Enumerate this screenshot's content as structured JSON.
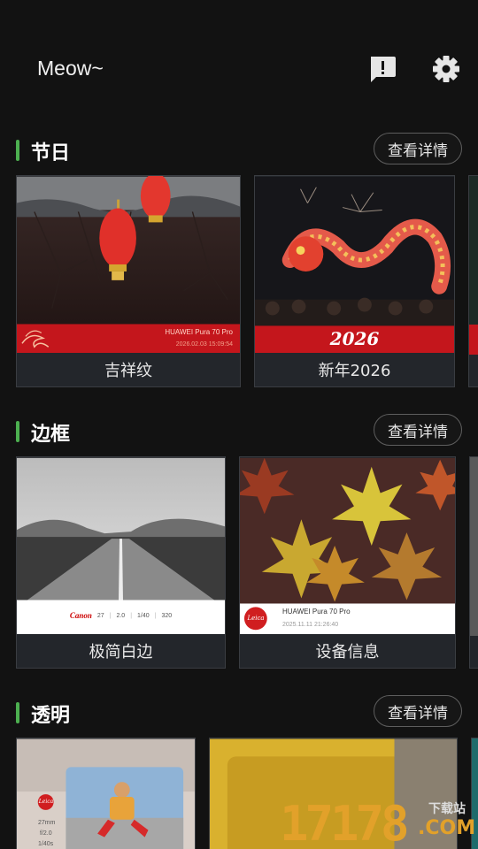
{
  "app": {
    "title": "Meow~"
  },
  "icons": {
    "feedback": "feedback-icon",
    "settings": "gear-icon"
  },
  "colors": {
    "accent": "#4caf50",
    "background": "#121212",
    "card": "#23262b",
    "banner_red": "#c4161c"
  },
  "sections": [
    {
      "title": "节日",
      "detail_label": "查看详情",
      "cards": [
        {
          "label": "吉祥纹",
          "camera": "HUAWEI Pura 70 Pro",
          "date": "2026.02.03 15:09:54"
        },
        {
          "label": "新年2026",
          "banner_text": "2026"
        }
      ]
    },
    {
      "title": "边框",
      "detail_label": "查看详情",
      "cards": [
        {
          "label": "极简白边",
          "brand": "Canon",
          "params": [
            "27",
            "2.0",
            "1/40",
            "320"
          ]
        },
        {
          "label": "设备信息",
          "brand": "Leica",
          "camera": "HUAWEI Pura 70 Pro",
          "date": "2025.11.11 21:26:40"
        }
      ]
    },
    {
      "title": "透明",
      "detail_label": "查看详情",
      "cards": [
        {
          "brand": "Leica",
          "params": [
            "27mm",
            "f/2.0",
            "1/40s"
          ]
        },
        {}
      ]
    }
  ],
  "watermark": {
    "number": "17178",
    "text": "下载站",
    "domain": ".COM"
  }
}
